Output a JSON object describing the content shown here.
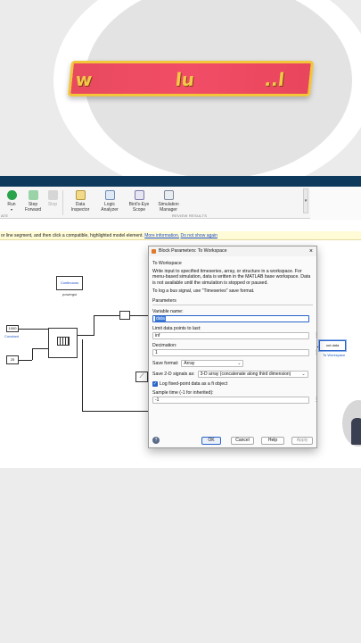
{
  "banner": {
    "letters": [
      "w",
      "lu",
      "..l"
    ]
  },
  "ribbon": {
    "run": "Run",
    "step_forward_1": "Step",
    "step_forward_2": "Forward",
    "stop": "Stop",
    "data_inspector_1": "Data",
    "data_inspector_2": "Inspector",
    "logic_analyzer_1": "Logic",
    "logic_analyzer_2": "Analyzer",
    "birds_eye_1": "Bird's-Eye",
    "birds_eye_2": "Scope",
    "sim_manager_1": "Simulation",
    "sim_manager_2": "Manager",
    "section_left": "ATE",
    "section_review": "REVIEW RESULTS",
    "scroll_arrow": "▾"
  },
  "hint": {
    "text": "or line segment, and then click a compatible, highlighted model element.",
    "link1": "More information.",
    "link2": "Do not show again"
  },
  "model": {
    "continuous": "Continuous",
    "powergui": "powergui",
    "const1": "1000",
    "const1_label": "Constant",
    "const2": "25",
    "out_block": "out.data",
    "out_label": "To Workspace"
  },
  "dialog": {
    "title": "Block Parameters: To Workspace",
    "close": "×",
    "subtitle": "To Workspace",
    "description": "Write input to specified timeseries, array, or structure in a workspace. For menu-based simulation, data is written in the MATLAB base workspace. Data is not available until the simulation is stopped or paused.",
    "bus_note": "To log a bus signal, use \"Timeseries\" save format.",
    "parameters": "Parameters",
    "var_name_label": "Variable name:",
    "var_name_value": "data",
    "limit_label": "Limit data points to last:",
    "limit_value": "inf",
    "decimation_label": "Decimation:",
    "decimation_value": "1",
    "save_format_label": "Save format:",
    "save_format_value": "Array",
    "save2d_label": "Save 2-D signals as:",
    "save2d_value": "3-D array (concatenate along third dimension)",
    "log_fixed_label": "Log fixed-point data as a fi object",
    "sample_time_label": "Sample time (-1 for inherited):",
    "sample_time_value": "-1",
    "ok": "OK",
    "cancel": "Cancel",
    "help": "Help",
    "apply": "Apply",
    "dots": "⋮"
  }
}
